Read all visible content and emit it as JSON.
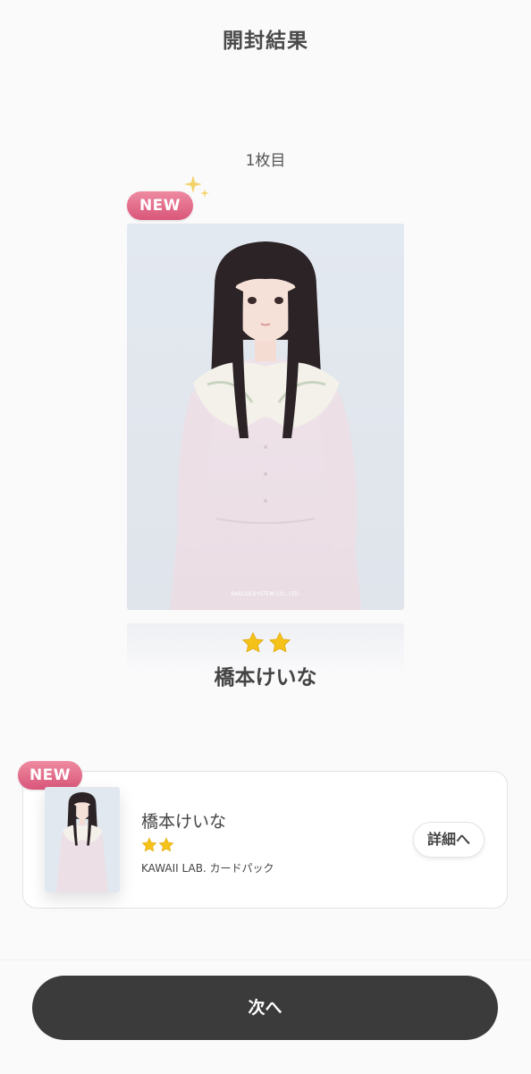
{
  "header": {
    "title": "開封結果"
  },
  "reveal": {
    "count_label": "1枚目",
    "badge": "NEW",
    "photo_credit": "RASCOESYSTEM CO., LTD.",
    "stars": 2,
    "name": "橋本けいな"
  },
  "result_item": {
    "badge": "NEW",
    "name": "橋本けいな",
    "stars": 2,
    "pack": "KAWAII LAB. カードパック",
    "detail_label": "詳細へ"
  },
  "footer": {
    "next_label": "次へ"
  },
  "colors": {
    "badge_pink": "#e0668a",
    "button_dark": "#3b3b3b",
    "star_gold": "#f5c21a"
  }
}
